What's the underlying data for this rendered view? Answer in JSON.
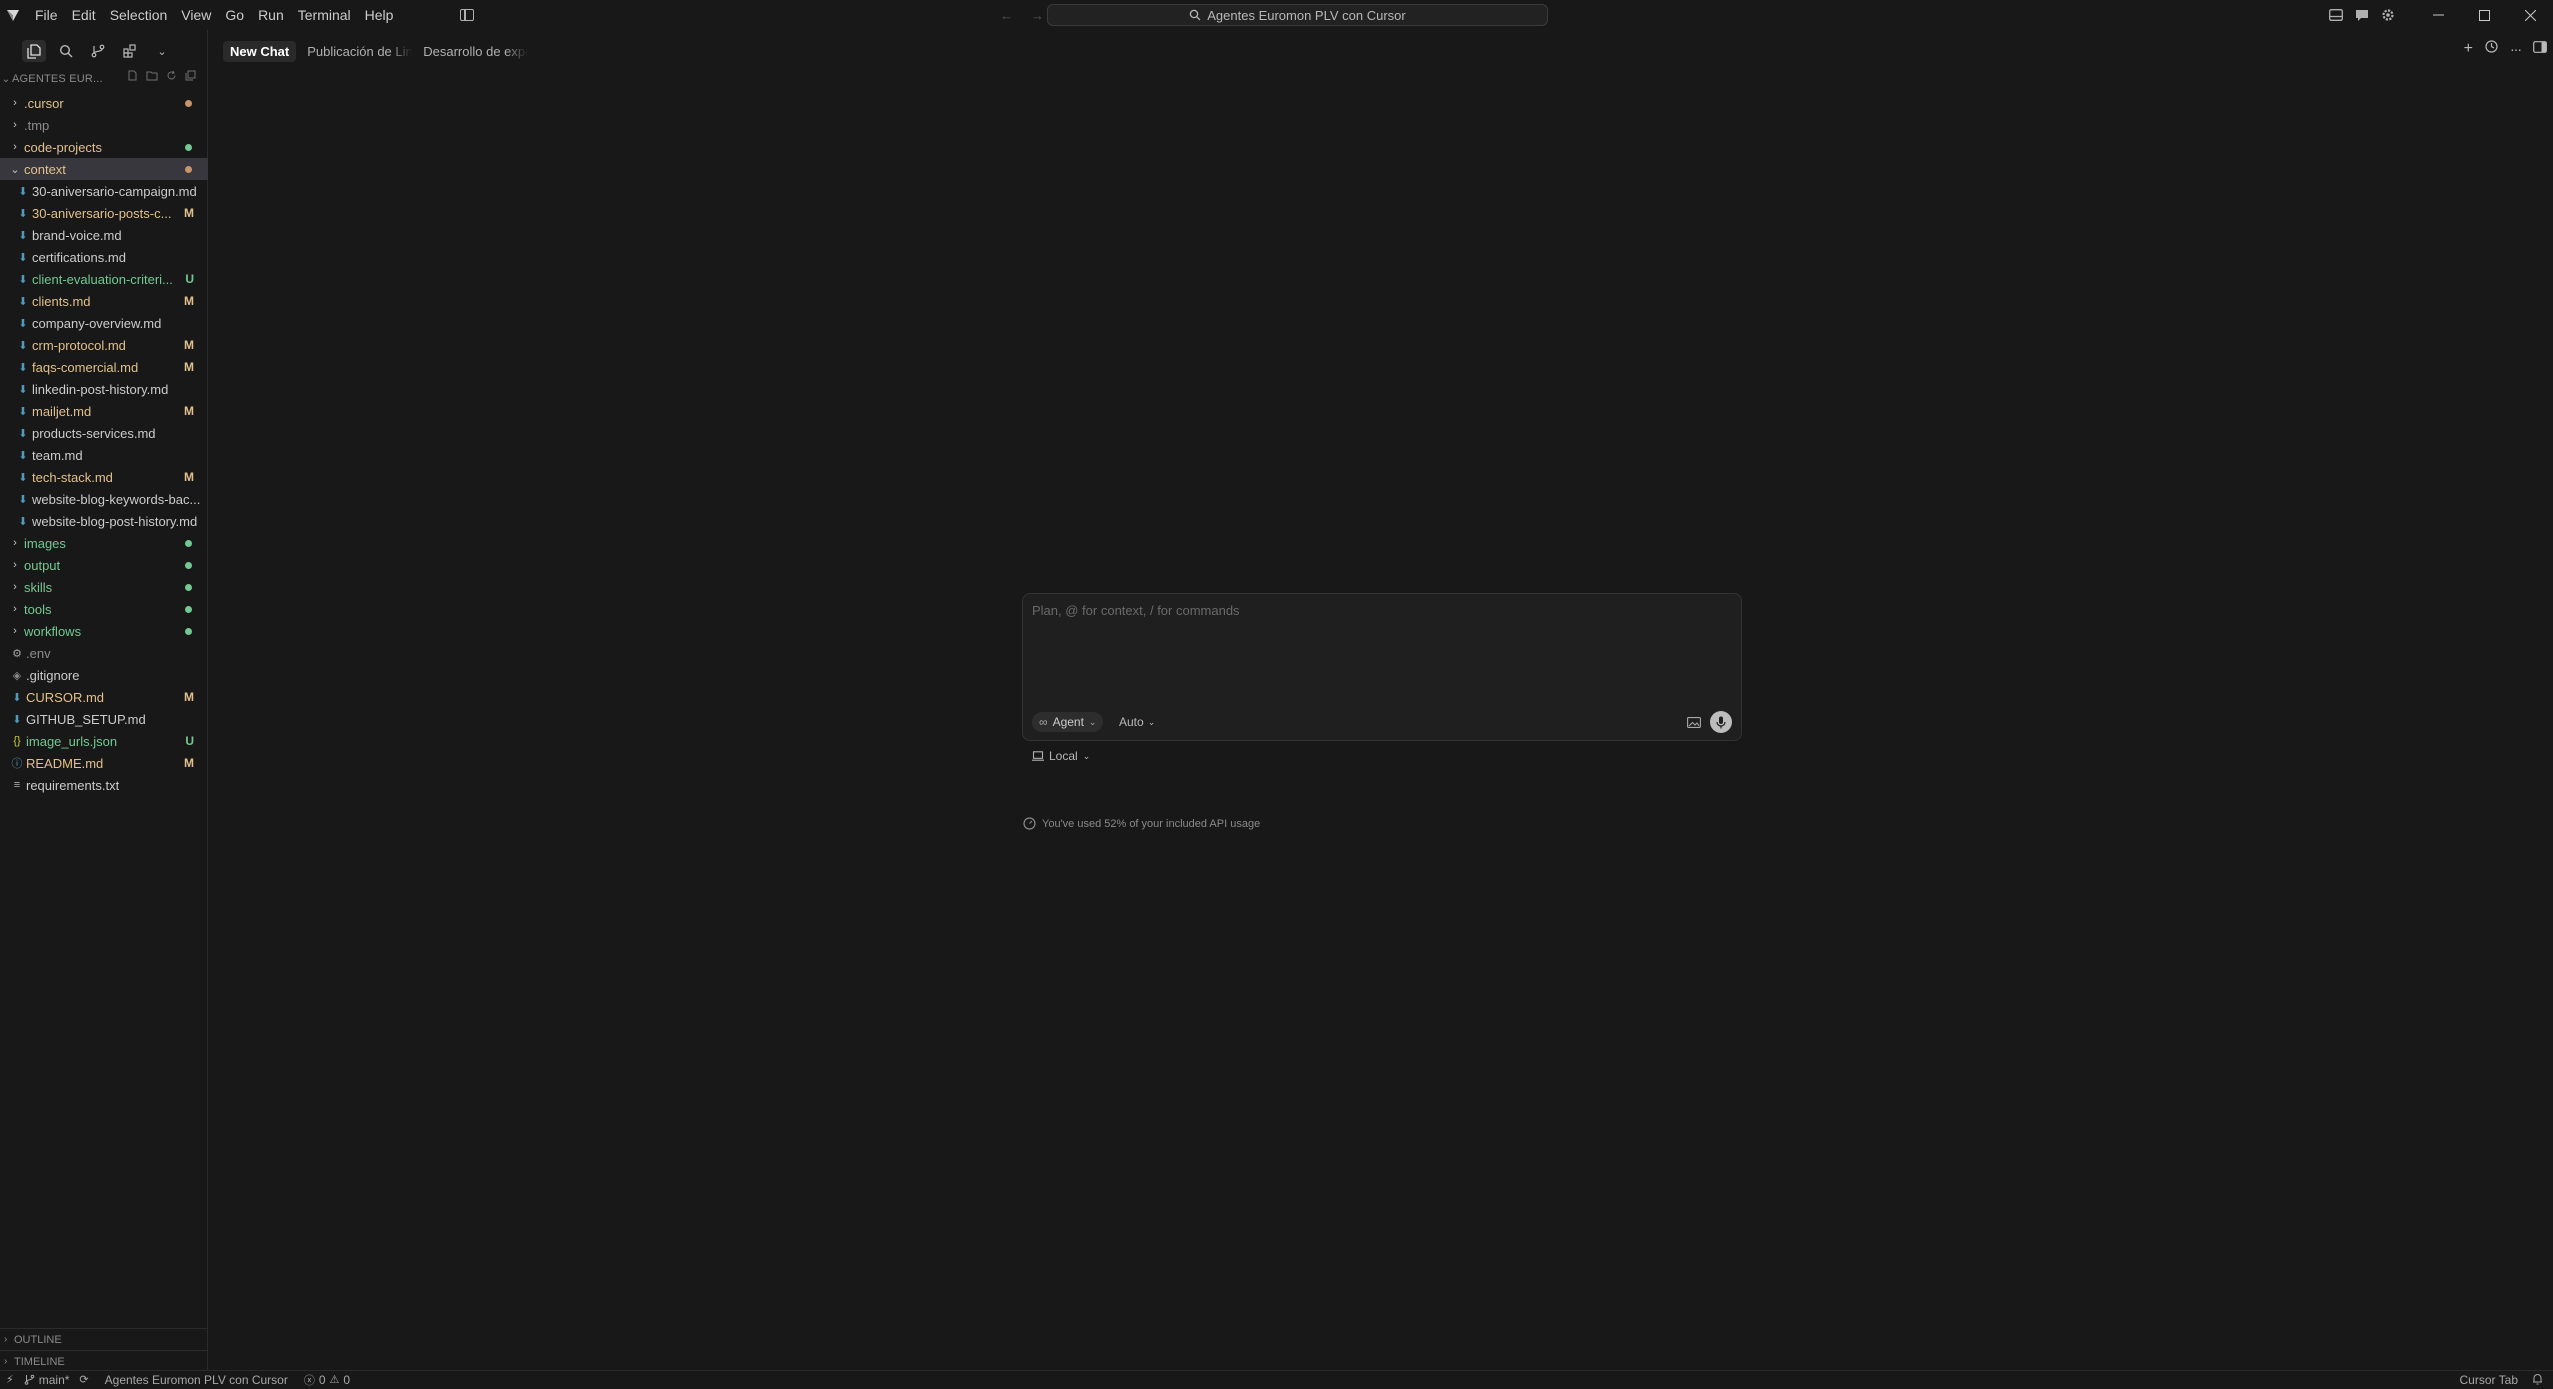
{
  "menu": [
    "File",
    "Edit",
    "Selection",
    "View",
    "Go",
    "Run",
    "Terminal",
    "Help"
  ],
  "search": {
    "label": "Agentes Euromon PLV con Cursor"
  },
  "explorer": {
    "title": "AGENTES EUR...",
    "items": [
      {
        "name": ".cursor",
        "type": "folder",
        "open": false,
        "color": "mod",
        "dot": "#c8956b",
        "badge": "",
        "level": 0
      },
      {
        "name": ".tmp",
        "type": "folder",
        "open": false,
        "color": "dim",
        "dot": "",
        "badge": "",
        "level": 0
      },
      {
        "name": "code-projects",
        "type": "folder",
        "open": false,
        "color": "mod",
        "dot": "#73c991",
        "badge": "",
        "level": 0
      },
      {
        "name": "context",
        "type": "folder",
        "open": true,
        "color": "mod",
        "dot": "#c8956b",
        "badge": "",
        "level": 0,
        "selected": true
      },
      {
        "name": "30-aniversario-campaign.md",
        "type": "md",
        "color": "plain",
        "dot": "",
        "badge": "",
        "level": 1
      },
      {
        "name": "30-aniversario-posts-c...",
        "type": "md",
        "color": "mod",
        "dot": "",
        "badge": "M",
        "level": 1
      },
      {
        "name": "brand-voice.md",
        "type": "md",
        "color": "plain",
        "dot": "",
        "badge": "",
        "level": 1
      },
      {
        "name": "certifications.md",
        "type": "md",
        "color": "plain",
        "dot": "",
        "badge": "",
        "level": 1
      },
      {
        "name": "client-evaluation-criteri...",
        "type": "md",
        "color": "untracked",
        "dot": "",
        "badge": "U",
        "level": 1
      },
      {
        "name": "clients.md",
        "type": "md",
        "color": "mod",
        "dot": "",
        "badge": "M",
        "level": 1
      },
      {
        "name": "company-overview.md",
        "type": "md",
        "color": "plain",
        "dot": "",
        "badge": "",
        "level": 1
      },
      {
        "name": "crm-protocol.md",
        "type": "md",
        "color": "mod",
        "dot": "",
        "badge": "M",
        "level": 1
      },
      {
        "name": "faqs-comercial.md",
        "type": "md",
        "color": "mod",
        "dot": "",
        "badge": "M",
        "level": 1
      },
      {
        "name": "linkedin-post-history.md",
        "type": "md",
        "color": "plain",
        "dot": "",
        "badge": "",
        "level": 1
      },
      {
        "name": "mailjet.md",
        "type": "md",
        "color": "mod",
        "dot": "",
        "badge": "M",
        "level": 1
      },
      {
        "name": "products-services.md",
        "type": "md",
        "color": "plain",
        "dot": "",
        "badge": "",
        "level": 1
      },
      {
        "name": "team.md",
        "type": "md",
        "color": "plain",
        "dot": "",
        "badge": "",
        "level": 1
      },
      {
        "name": "tech-stack.md",
        "type": "md",
        "color": "mod",
        "dot": "",
        "badge": "M",
        "level": 1
      },
      {
        "name": "website-blog-keywords-bac...",
        "type": "md",
        "color": "plain",
        "dot": "",
        "badge": "",
        "level": 1
      },
      {
        "name": "website-blog-post-history.md",
        "type": "md",
        "color": "plain",
        "dot": "",
        "badge": "",
        "level": 1
      },
      {
        "name": "images",
        "type": "folder",
        "open": false,
        "color": "untracked",
        "dot": "#73c991",
        "badge": "",
        "level": 0
      },
      {
        "name": "output",
        "type": "folder",
        "open": false,
        "color": "untracked",
        "dot": "#73c991",
        "badge": "",
        "level": 0
      },
      {
        "name": "skills",
        "type": "folder",
        "open": false,
        "color": "untracked",
        "dot": "#73c991",
        "badge": "",
        "level": 0
      },
      {
        "name": "tools",
        "type": "folder",
        "open": false,
        "color": "untracked",
        "dot": "#73c991",
        "badge": "",
        "level": 0
      },
      {
        "name": "workflows",
        "type": "folder",
        "open": false,
        "color": "untracked",
        "dot": "#73c991",
        "badge": "",
        "level": 0
      },
      {
        "name": ".env",
        "type": "env",
        "color": "dim",
        "dot": "",
        "badge": "",
        "level": 0
      },
      {
        "name": ".gitignore",
        "type": "git",
        "color": "plain",
        "dot": "",
        "badge": "",
        "level": 0
      },
      {
        "name": "CURSOR.md",
        "type": "md",
        "color": "mod",
        "dot": "",
        "badge": "M",
        "level": 0
      },
      {
        "name": "GITHUB_SETUP.md",
        "type": "md",
        "color": "plain",
        "dot": "",
        "badge": "",
        "level": 0
      },
      {
        "name": "image_urls.json",
        "type": "json",
        "color": "untracked",
        "dot": "",
        "badge": "U",
        "level": 0
      },
      {
        "name": "README.md",
        "type": "info",
        "color": "mod",
        "dot": "",
        "badge": "M",
        "level": 0
      },
      {
        "name": "requirements.txt",
        "type": "txt",
        "color": "plain",
        "dot": "",
        "badge": "",
        "level": 0
      }
    ]
  },
  "panels": {
    "outline": "OUTLINE",
    "timeline": "TIMELINE"
  },
  "tabs": [
    {
      "label": "New Chat",
      "active": true
    },
    {
      "label": "Publicación de LinkedIn",
      "active": false
    },
    {
      "label": "Desarrollo de expositor",
      "active": false
    }
  ],
  "chat": {
    "placeholder": "Plan, @ for context, / for commands",
    "mode": "Agent",
    "model": "Auto",
    "location": "Local",
    "usage": "You've used 52% of your included API usage"
  },
  "status": {
    "branch": "main*",
    "workspace": "Agentes Euromon PLV con Cursor",
    "errors": "0",
    "warnings": "0",
    "right_label": "Cursor Tab"
  },
  "colors": {
    "modified": "#e2c08d",
    "untracked": "#73c991",
    "background": "#181818"
  }
}
